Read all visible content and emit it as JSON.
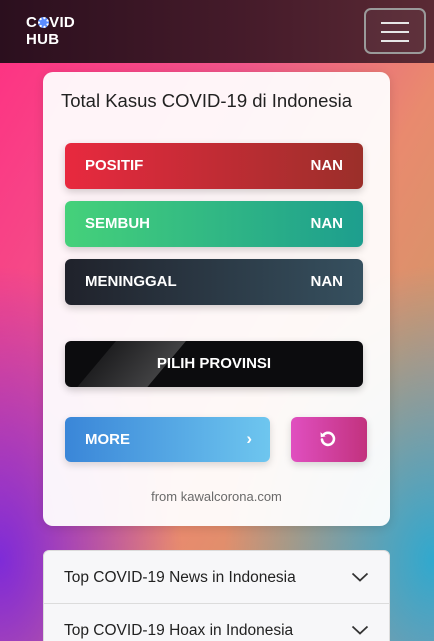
{
  "navbar": {
    "brand_line1_a": "C",
    "brand_line1_b": "VID",
    "brand_line2": "HUB",
    "menu_icon": "hamburger-icon"
  },
  "card": {
    "title": "Total Kasus COVID-19 di Indonesia",
    "stats": [
      {
        "label": "POSITIF",
        "value": "NAN"
      },
      {
        "label": "SEMBUH",
        "value": "NAN"
      },
      {
        "label": "MENINGGAL",
        "value": "NAN"
      }
    ],
    "province_button": "PILIH PROVINSI",
    "more_button": "MORE",
    "more_icon": "›",
    "refresh_icon": "refresh-icon",
    "source": "from kawalcorona.com"
  },
  "accordion": [
    {
      "label": "Top COVID-19 News in Indonesia"
    },
    {
      "label": "Top COVID-19 Hoax in Indonesia"
    }
  ],
  "colors": {
    "positif": "#e8293f",
    "sembuh": "#45d17a",
    "meninggal": "#20222b",
    "more": "#3a86d8",
    "refresh": "#e04fc0"
  }
}
